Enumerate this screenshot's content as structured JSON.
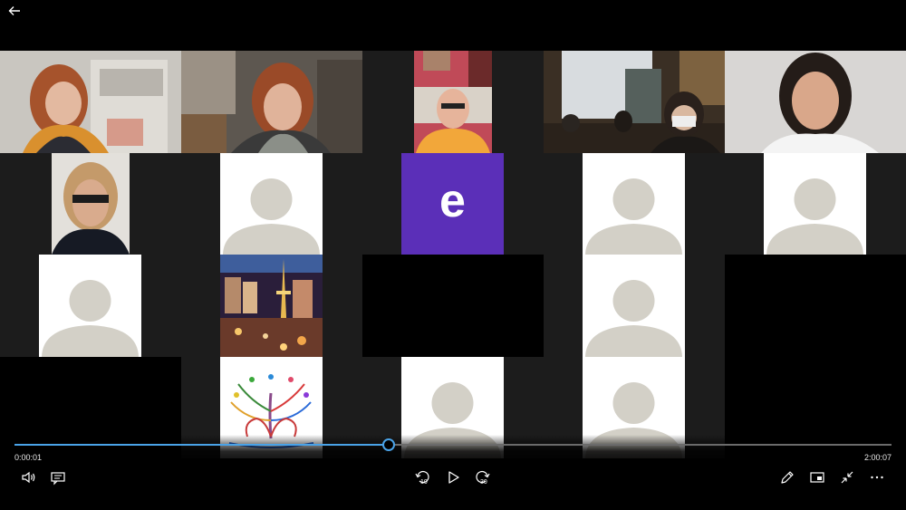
{
  "app": {
    "back_icon": "back-arrow-icon"
  },
  "video": {
    "grid_background": "#1c1c1c",
    "participants": [
      {
        "kind": "photo",
        "desc_icon": "participant-video"
      },
      {
        "kind": "photo",
        "desc_icon": "participant-video"
      },
      {
        "kind": "photo",
        "desc_icon": "participant-video"
      },
      {
        "kind": "photo",
        "desc_icon": "participant-video"
      },
      {
        "kind": "photo",
        "desc_icon": "participant-video"
      },
      {
        "kind": "photo",
        "desc_icon": "participant-video"
      },
      {
        "kind": "avatar"
      },
      {
        "kind": "initial",
        "initial": "e",
        "color": "#5b2fb8"
      },
      {
        "kind": "avatar"
      },
      {
        "kind": "avatar"
      },
      {
        "kind": "avatar"
      },
      {
        "kind": "image"
      },
      {
        "kind": "avatar"
      },
      {
        "kind": "image"
      },
      {
        "kind": "avatar"
      },
      {
        "kind": "avatar"
      }
    ]
  },
  "player": {
    "current_time": "0:00:01",
    "total_time": "2:00:07",
    "progress_fraction": 0.427,
    "accent": "#4aa3e8",
    "left_buttons": [
      "volume-icon",
      "captions-icon"
    ],
    "center_buttons": [
      "skip-back-10-icon",
      "play-icon",
      "skip-forward-30-icon"
    ],
    "skip_back_label": "10",
    "skip_forward_label": "30",
    "right_buttons": [
      "edit-icon",
      "mini-view-icon",
      "exit-fullscreen-icon",
      "more-options-icon"
    ]
  }
}
